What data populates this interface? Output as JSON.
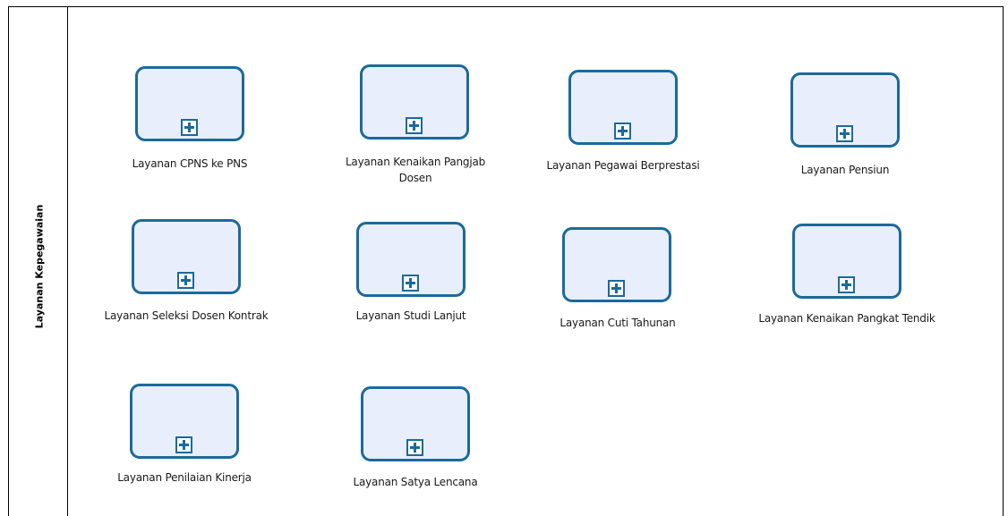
{
  "lane": {
    "title": "Layanan Kepegawaian"
  },
  "tasks": [
    {
      "label": "Layanan CPNS ke PNS"
    },
    {
      "label": "Layanan Kenaikan Pangjab Dosen"
    },
    {
      "label": "Layanan Pegawai Berprestasi"
    },
    {
      "label": "Layanan Pensiun"
    },
    {
      "label": "Layanan Seleksi Dosen Kontrak"
    },
    {
      "label": "Layanan Studi Lanjut"
    },
    {
      "label": "Layanan Cuti Tahunan"
    },
    {
      "label": "Layanan Kenaikan Pangkat Tendik"
    },
    {
      "label": "Layanan Penilaian Kinerja"
    },
    {
      "label": "Layanan Satya Lencana"
    }
  ],
  "colors": {
    "task_border": "#1b6a9b",
    "task_fill": "#e9eefc",
    "line": "#000000"
  },
  "icons": {
    "task_marker": "collapsed-subprocess-plus-icon"
  }
}
